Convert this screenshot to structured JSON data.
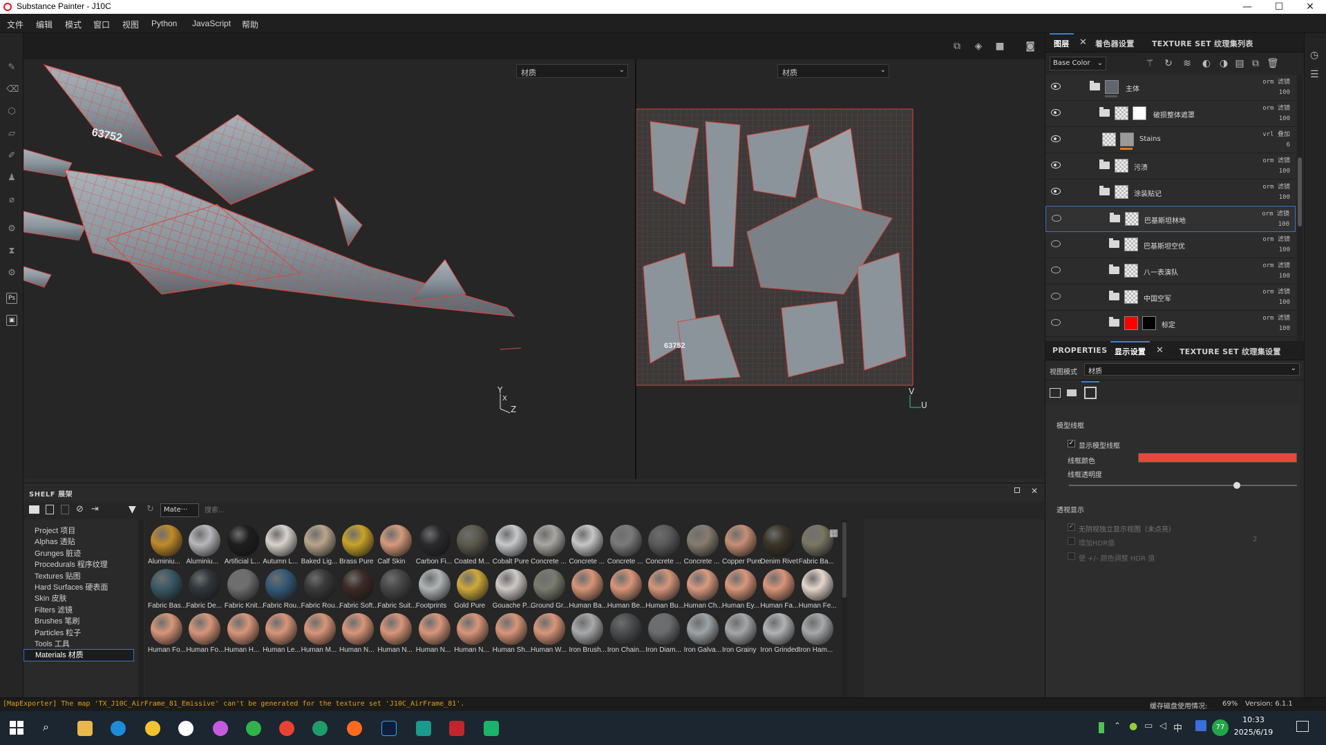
{
  "window": {
    "title": "Substance Painter - J10C"
  },
  "menu": [
    "文件",
    "编辑",
    "模式",
    "窗口",
    "视图",
    "Python",
    "JavaScript",
    "帮助"
  ],
  "viewport": {
    "left_mode": "材质",
    "right_mode": "材质",
    "left_axis": {
      "y": "Y",
      "x": "X",
      "z": "Z"
    },
    "right_axis": {
      "v": "V",
      "u": "U"
    },
    "model_number": "63752"
  },
  "layers_panel": {
    "tabs": [
      "图层",
      "着色器设置",
      "TEXTURE SET 纹理集列表"
    ],
    "channel": "Base Color",
    "layers": [
      {
        "name": "主体",
        "blend": "orm 滤镜",
        "opacity": "100",
        "visible": true
      },
      {
        "name": "破损整体遮罩",
        "blend": "orm 滤镜",
        "opacity": "100",
        "visible": true
      },
      {
        "name": "Stains",
        "blend": "vrl 叠加",
        "opacity": "6",
        "visible": true
      },
      {
        "name": "污渍",
        "blend": "orm 滤镜",
        "opacity": "100",
        "visible": true
      },
      {
        "name": "涂装贴记",
        "blend": "orm 滤镜",
        "opacity": "100",
        "visible": true
      },
      {
        "name": "巴基斯坦林地",
        "blend": "orm 滤镜",
        "opacity": "100",
        "visible": false
      },
      {
        "name": "巴基斯坦空优",
        "blend": "orm 滤镜",
        "opacity": "100",
        "visible": false
      },
      {
        "name": "八一表演队",
        "blend": "orm 滤镜",
        "opacity": "100",
        "visible": false
      },
      {
        "name": "中国空军",
        "blend": "orm 滤镜",
        "opacity": "100",
        "visible": false
      },
      {
        "name": "标定",
        "blend": "orm 滤镜",
        "opacity": "100",
        "visible": false
      }
    ]
  },
  "props_panel": {
    "tabs": [
      "PROPERTIES",
      "显示设置",
      "TEXTURE SET 纹理集设置"
    ],
    "view_mode_label": "视图模式",
    "view_mode_value": "材质",
    "wireframe_section": "模型线框",
    "show_wireframe": "显示模型线框",
    "wire_color_label": "线框颜色",
    "wire_color": "#e8473a",
    "wire_opacity_label": "线框透明度",
    "wire_opacity": 0.72,
    "alpha_section": "透视显示",
    "alpha_option": "无阴视独立显示视图（未点亮）",
    "hdr_label": "增加HDR值",
    "hdr_adjust": "使 +/- 颜色调整 HDR 值",
    "hdr_value": "2"
  },
  "shelf": {
    "title": "SHELF 展架",
    "filter_tag": "Mate···",
    "search_placeholder": "搜索...",
    "categories": [
      "Project 项目",
      "Alphas 透贴",
      "Grunges 脏迹",
      "Procedurals 程序纹理",
      "Textures 贴图",
      "Hard Surfaces 硬表面",
      "Skin 皮肤",
      "Filters 滤镜",
      "Brushes 笔刷",
      "Particles 粒子",
      "Tools 工具",
      "Materials 材质"
    ],
    "selected_category": "Materials 材质",
    "materials": [
      {
        "name": "Aluminiu...",
        "color": "#c08a2a"
      },
      {
        "name": "Aluminiu...",
        "color": "#b8b8bc"
      },
      {
        "name": "Artificial L...",
        "color": "#1e1e1e"
      },
      {
        "name": "Autumn L...",
        "color": "#d9d3cc"
      },
      {
        "name": "Baked Lig...",
        "color": "#b9a58e"
      },
      {
        "name": "Brass Pure",
        "color": "#c9a22a"
      },
      {
        "name": "Calf Skin",
        "color": "#d69a7c"
      },
      {
        "name": "Carbon Fi...",
        "color": "#2a2a2e"
      },
      {
        "name": "Coated M...",
        "color": "#5c5a4d"
      },
      {
        "name": "Cobalt Pure",
        "color": "#c8c9cc"
      },
      {
        "name": "Concrete ...",
        "color": "#a8a6a2"
      },
      {
        "name": "Concrete ...",
        "color": "#c6c6c6"
      },
      {
        "name": "Concrete ...",
        "color": "#7a7a7a"
      },
      {
        "name": "Concrete ...",
        "color": "#5a5a5a"
      },
      {
        "name": "Concrete ...",
        "color": "#867c6f"
      },
      {
        "name": "Copper Pure",
        "color": "#c58f74"
      },
      {
        "name": "Denim Rivet",
        "color": "#3b3428"
      },
      {
        "name": "Fabric Ba...",
        "color": "#7a7763"
      },
      {
        "name": "Fabric Bas...",
        "color": "#3a5966"
      },
      {
        "name": "Fabric De...",
        "color": "#30363c"
      },
      {
        "name": "Fabric Knit...",
        "color": "#6e6e6e"
      },
      {
        "name": "Fabric Rou...",
        "color": "#355a78"
      },
      {
        "name": "Fabric Rou...",
        "color": "#3a3a3a"
      },
      {
        "name": "Fabric Soft...",
        "color": "#3d2a26"
      },
      {
        "name": "Fabric Suit...",
        "color": "#474747"
      },
      {
        "name": "Footprints",
        "color": "#b0b4b6"
      },
      {
        "name": "Gold Pure",
        "color": "#cfa93a"
      },
      {
        "name": "Gouache P...",
        "color": "#cfc9c6"
      },
      {
        "name": "Ground Gr...",
        "color": "#7a7c70"
      },
      {
        "name": "Human Ba...",
        "color": "#d89478"
      },
      {
        "name": "Human Be...",
        "color": "#d8967a"
      },
      {
        "name": "Human Bu...",
        "color": "#d5967b"
      },
      {
        "name": "Human Ch...",
        "color": "#d99a80"
      },
      {
        "name": "Human Ey...",
        "color": "#d9977c"
      },
      {
        "name": "Human Fa...",
        "color": "#d9957a"
      },
      {
        "name": "Human Fe...",
        "color": "#e4d6cc"
      },
      {
        "name": "Human Fo...",
        "color": "#d8967a"
      },
      {
        "name": "Human Fo...",
        "color": "#d8967a"
      },
      {
        "name": "Human H...",
        "color": "#d8967a"
      },
      {
        "name": "Human Le...",
        "color": "#d8967a"
      },
      {
        "name": "Human M...",
        "color": "#d8967a"
      },
      {
        "name": "Human N...",
        "color": "#d8967a"
      },
      {
        "name": "Human N...",
        "color": "#d8967a"
      },
      {
        "name": "Human N...",
        "color": "#d8967a"
      },
      {
        "name": "Human N...",
        "color": "#d8967a"
      },
      {
        "name": "Human Sh...",
        "color": "#d8967a"
      },
      {
        "name": "Human W...",
        "color": "#d8967a"
      },
      {
        "name": "Iron Brush...",
        "color": "#a8a9aa"
      },
      {
        "name": "Iron Chain...",
        "color": "#4a4c4e"
      },
      {
        "name": "Iron Diam...",
        "color": "#6a6c6e"
      },
      {
        "name": "Iron Galva...",
        "color": "#9ea3a6"
      },
      {
        "name": "Iron Grainy",
        "color": "#a4a6a8"
      },
      {
        "name": "Iron Grinded",
        "color": "#b0b2b4"
      },
      {
        "name": "Iron Ham...",
        "color": "#a6a8aa"
      }
    ]
  },
  "status": {
    "message": "[MapExporter] The map 'TX_J10C_AirFrame_81_Emissive' can't be generated for the texture set 'J10C_AirFrame_81'.",
    "cache_label": "缓存磁盘使用情况:",
    "cache_value": "69%",
    "version": "Version: 6.1.1"
  },
  "taskbar": {
    "time": "10:33",
    "date": "2025/6/19",
    "ime": "中",
    "badge": "77"
  }
}
